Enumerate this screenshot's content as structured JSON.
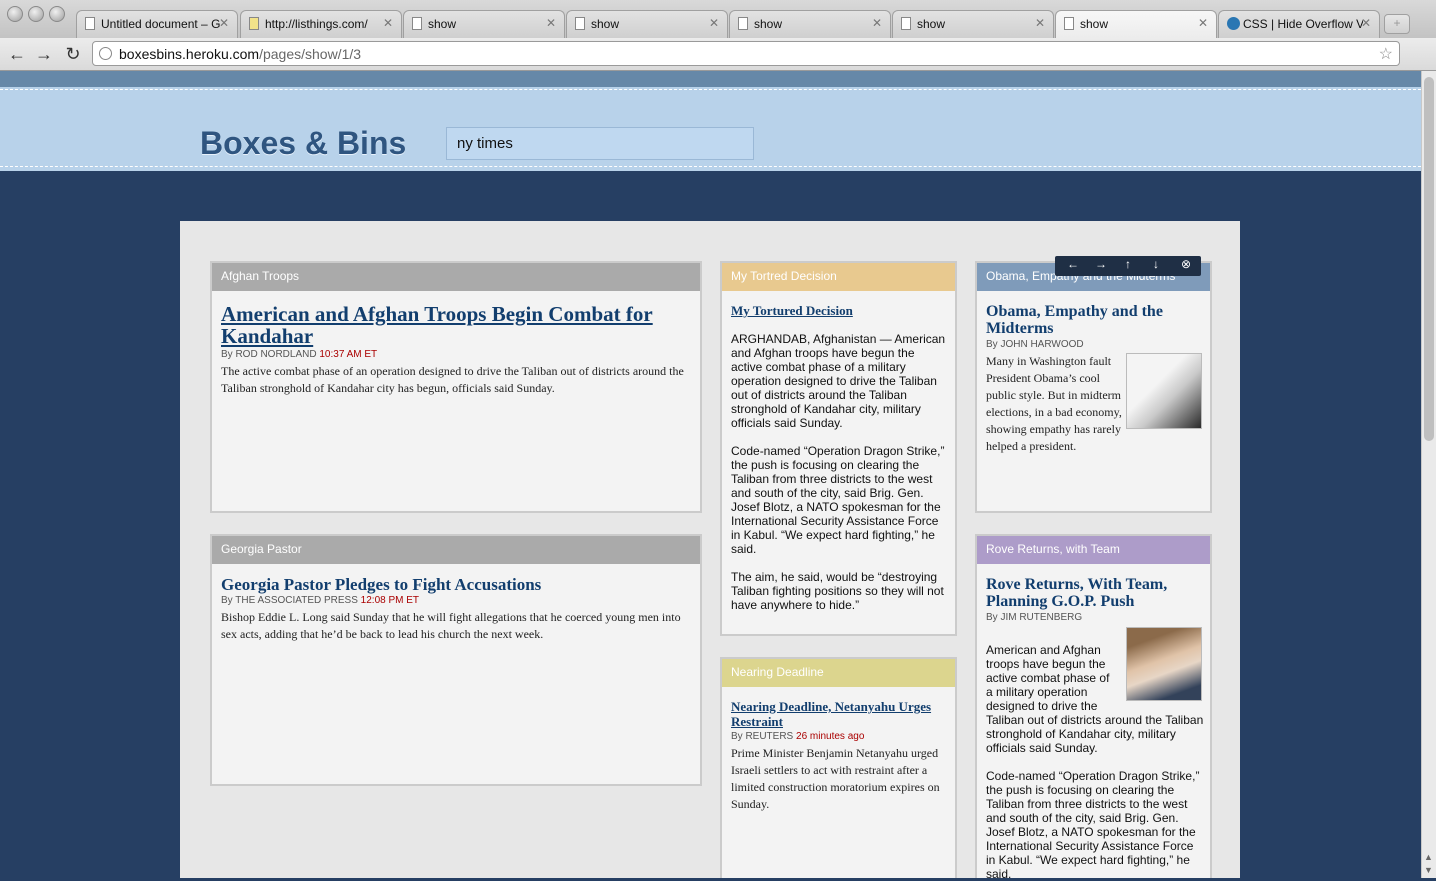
{
  "browser": {
    "tabs": [
      {
        "label": "Untitled document – G"
      },
      {
        "label": "http://listhings.com/"
      },
      {
        "label": "show"
      },
      {
        "label": "show"
      },
      {
        "label": "show"
      },
      {
        "label": "show"
      },
      {
        "label": "show"
      },
      {
        "label": "CSS | Hide Overflow V"
      }
    ],
    "url_host": "boxesbins.heroku.com",
    "url_path": "/pages/show/1/3"
  },
  "site": {
    "logo": "Boxes & Bins",
    "search_value": "ny times"
  },
  "controls": [
    "←",
    "→",
    "↑",
    "↓",
    "⊗"
  ],
  "boxes": {
    "afghan": {
      "header": "Afghan Troops",
      "header_color": "#aaaaaa",
      "title": "American and Afghan Troops Begin Combat for Kandahar",
      "byline": "By ROD NORDLAND",
      "time": "10:37 AM ET",
      "body": "The active combat phase of an operation designed to drive the Taliban out of districts around the Taliban stronghold of Kandahar city has begun, officials said Sunday."
    },
    "georgia": {
      "header": "Georgia Pastor",
      "header_color": "#aaaaaa",
      "title": "Georgia Pastor Pledges to Fight Accusations",
      "byline": "By THE ASSOCIATED PRESS",
      "time": "12:08 PM ET",
      "body": "Bishop Eddie L. Long said Sunday that he will fight allegations that he coerced young men into sex acts, adding that he’d be back to lead his church the next week."
    },
    "tortured": {
      "header": "My Tortred Decision",
      "header_color": "#e8c98f",
      "title": "My Tortured Decision",
      "p1": "ARGHANDAB, Afghanistan — American and Afghan troops have begun the active combat phase of a military operation designed to drive the Taliban out of districts around the Taliban stronghold of Kandahar city, military officials said Sunday.",
      "p2": "Code-named “Operation Dragon Strike,” the push is focusing on clearing the Taliban from three districts to the west and south of the city, said Brig. Gen. Josef Blotz, a NATO spokesman for the International Security Assistance Force in Kabul. “We expect hard fighting,” he said.",
      "p3": "The aim, he said, would be “destroying Taliban fighting positions so they will not have anywhere to hide.”"
    },
    "netanyahu": {
      "header": "Nearing Deadline",
      "header_color": "#dcd58e",
      "title": "Nearing Deadline, Netanyahu Urges Restraint",
      "byline": "By REUTERS",
      "time": "26 minutes ago",
      "body": "Prime Minister Benjamin Netanyahu urged Israeli settlers to act with restraint after a limited construction moratorium expires on Sunday."
    },
    "obama": {
      "header": "Obama, Empathy and the Midterms",
      "header_color": "#7f9bba",
      "title": "Obama, Empathy and the Midterms",
      "byline": "By JOHN HARWOOD",
      "body": "Many in Washington fault President Obama’s cool public style. But in midterm elections, in a bad economy, showing empathy has rarely helped a president."
    },
    "rove": {
      "header": "Rove Returns, with Team",
      "header_color": "#ad9cc9",
      "title": "Rove Returns, With Team, Planning G.O.P. Push",
      "byline": "By JIM RUTENBERG",
      "p1": "American and Afghan troops have begun the active combat phase of a military operation designed to drive the Taliban out of districts around the Taliban stronghold of Kandahar city, military officials said Sunday.",
      "p2": "Code-named “Operation Dragon Strike,” the push is focusing on clearing the Taliban from three districts to the west and south of the city, said Brig. Gen. Josef Blotz, a NATO spokesman for the International Security Assistance Force in Kabul. “We expect hard fighting,” he said."
    }
  }
}
